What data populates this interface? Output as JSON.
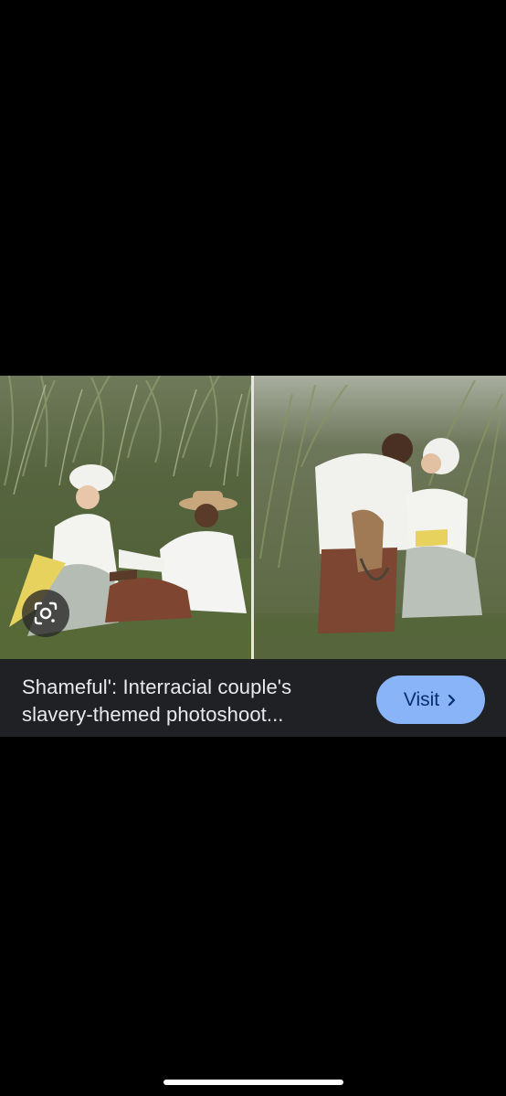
{
  "result": {
    "caption_line1": "Shameful': Interracial couple's",
    "caption_line2": "slavery-themed photoshoot...",
    "visit_label": "Visit"
  },
  "icons": {
    "lens": "google-lens-icon",
    "visit_arrow": "chevron-right-icon"
  },
  "colors": {
    "background": "#000000",
    "info_bar": "#202124",
    "caption_text": "#e8eaed",
    "visit_button": "#8ab4f8",
    "visit_text": "#062e6f"
  }
}
